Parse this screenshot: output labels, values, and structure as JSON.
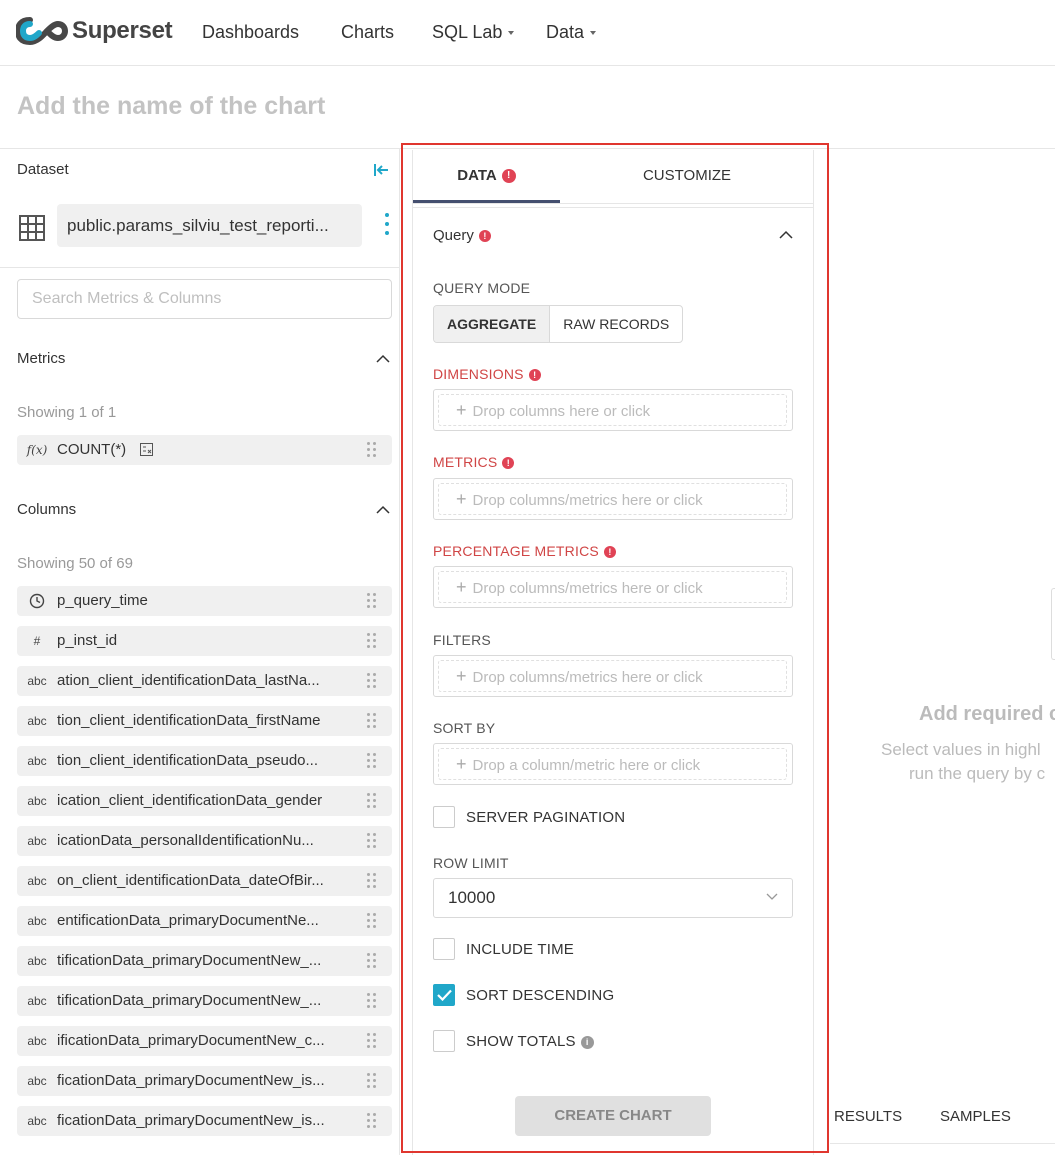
{
  "nav": {
    "brand": "Superset",
    "items": [
      {
        "label": "Dashboards"
      },
      {
        "label": "Charts"
      },
      {
        "label": "SQL Lab"
      },
      {
        "label": "Data"
      }
    ]
  },
  "chart_name_placeholder": "Add the name of the chart",
  "dataset": {
    "label": "Dataset",
    "name": "public.params_silviu_test_reporti..."
  },
  "search": {
    "placeholder": "Search Metrics & Columns"
  },
  "metrics": {
    "title": "Metrics",
    "showing": "Showing 1 of 1",
    "items": [
      {
        "type": "f(x)",
        "name": "COUNT(*)"
      }
    ]
  },
  "columns": {
    "title": "Columns",
    "showing": "Showing 50 of 69",
    "items": [
      {
        "type": "clock",
        "name": "p_query_time"
      },
      {
        "type": "#",
        "name": "p_inst_id"
      },
      {
        "type": "abc",
        "name": "ation_client_identificationData_lastNa..."
      },
      {
        "type": "abc",
        "name": "tion_client_identificationData_firstName"
      },
      {
        "type": "abc",
        "name": "tion_client_identificationData_pseudo..."
      },
      {
        "type": "abc",
        "name": "ication_client_identificationData_gender"
      },
      {
        "type": "abc",
        "name": "icationData_personalIdentificationNu..."
      },
      {
        "type": "abc",
        "name": "on_client_identificationData_dateOfBir..."
      },
      {
        "type": "abc",
        "name": "entificationData_primaryDocumentNe..."
      },
      {
        "type": "abc",
        "name": "tificationData_primaryDocumentNew_..."
      },
      {
        "type": "abc",
        "name": "tificationData_primaryDocumentNew_..."
      },
      {
        "type": "abc",
        "name": "ificationData_primaryDocumentNew_c..."
      },
      {
        "type": "abc",
        "name": "ficationData_primaryDocumentNew_is..."
      },
      {
        "type": "abc",
        "name": "ficationData_primaryDocumentNew_is..."
      }
    ]
  },
  "control_panel": {
    "tabs": {
      "data": "DATA",
      "customize": "CUSTOMIZE"
    },
    "query_section": "Query",
    "query_mode": {
      "label": "QUERY MODE",
      "options": [
        "AGGREGATE",
        "RAW RECORDS"
      ],
      "selected": "AGGREGATE"
    },
    "dimensions": {
      "label": "DIMENSIONS",
      "placeholder": "Drop columns here or click"
    },
    "metrics": {
      "label": "METRICS",
      "placeholder": "Drop columns/metrics here or click"
    },
    "percentage_metrics": {
      "label": "PERCENTAGE METRICS",
      "placeholder": "Drop columns/metrics here or click"
    },
    "filters": {
      "label": "FILTERS",
      "placeholder": "Drop columns/metrics here or click"
    },
    "sort_by": {
      "label": "SORT BY",
      "placeholder": "Drop a column/metric here or click"
    },
    "server_pagination": {
      "label": "SERVER PAGINATION",
      "checked": false
    },
    "row_limit": {
      "label": "ROW LIMIT",
      "value": "10000"
    },
    "include_time": {
      "label": "INCLUDE TIME",
      "checked": false
    },
    "sort_descending": {
      "label": "SORT DESCENDING",
      "checked": true
    },
    "show_totals": {
      "label": "SHOW TOTALS",
      "checked": false
    },
    "create_button": "CREATE CHART"
  },
  "chart_area": {
    "title": "Add required c",
    "line1": "Select values in highl",
    "line2": "run the query by c",
    "tabs": [
      "RESULTS",
      "SAMPLES"
    ]
  },
  "colors": {
    "accent": "#20a7c9",
    "error": "#e04355",
    "highlight_border": "#e0362f",
    "active_tab": "#444f6f"
  }
}
